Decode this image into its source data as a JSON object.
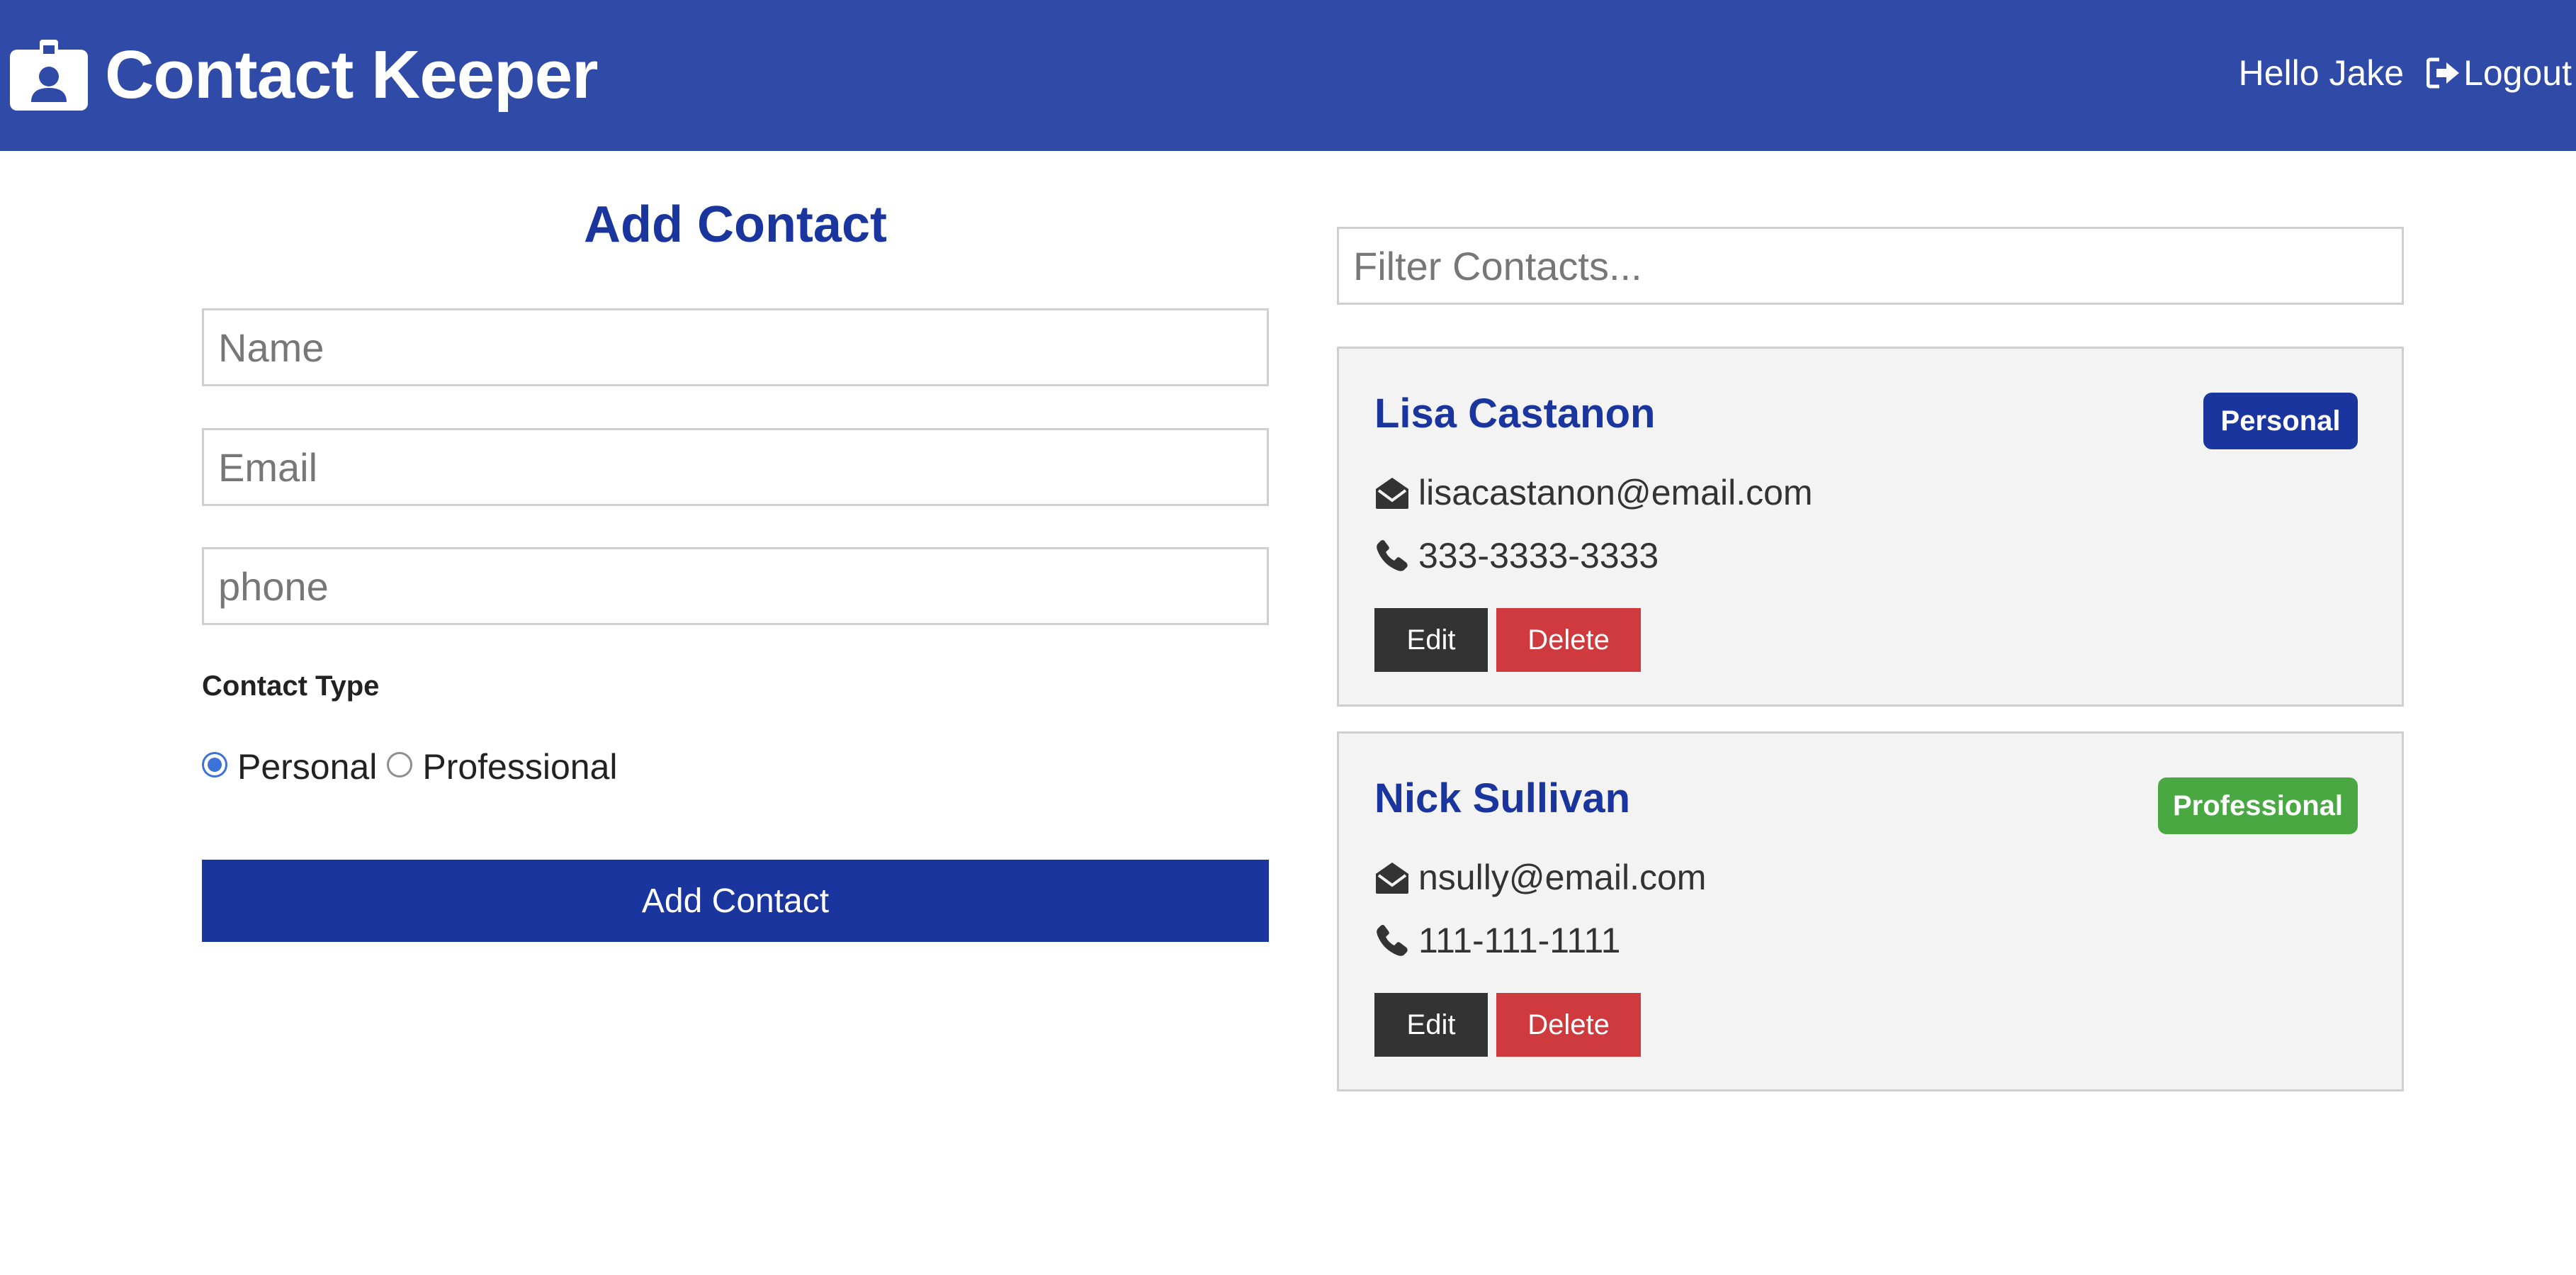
{
  "navbar": {
    "brand_icon": "id-badge-icon",
    "title": "Contact Keeper",
    "greeting": "Hello Jake",
    "logout_icon": "sign-out-icon",
    "logout_label": "Logout",
    "background_color": "#304ba7"
  },
  "form": {
    "title": "Add Contact",
    "name_placeholder": "Name",
    "email_placeholder": "Email",
    "phone_placeholder": "phone",
    "contact_type_label": "Contact Type",
    "type_options": [
      {
        "label": "Personal",
        "checked": true
      },
      {
        "label": "Professional",
        "checked": false
      }
    ],
    "submit_label": "Add Contact",
    "accent_color": "#1a359e"
  },
  "filter": {
    "placeholder": "Filter Contacts..."
  },
  "contacts": [
    {
      "name": "Lisa Castanon",
      "type": "Personal",
      "badge_color": "#1a359e",
      "email": "lisacastanon@email.com",
      "phone": "333-3333-3333",
      "edit_label": "Edit",
      "delete_label": "Delete"
    },
    {
      "name": "Nick Sullivan",
      "type": "Professional",
      "badge_color": "#4aa843",
      "email": "nsully@email.com",
      "phone": "111-111-1111",
      "edit_label": "Edit",
      "delete_label": "Delete"
    }
  ],
  "icons": {
    "email": "envelope-open-icon",
    "phone": "phone-icon"
  },
  "colors": {
    "edit_button": "#333333",
    "delete_button": "#cf3a3f",
    "card_background": "#f3f3f3"
  }
}
